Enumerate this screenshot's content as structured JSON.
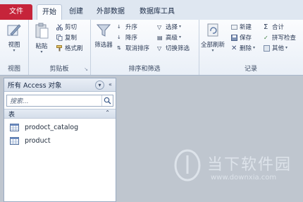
{
  "tabs": {
    "file": "文件",
    "items": [
      "开始",
      "创建",
      "外部数据",
      "数据库工具"
    ]
  },
  "ribbon": {
    "views": {
      "view_label": "视图",
      "group_label": "视图"
    },
    "clipboard": {
      "paste_label": "粘贴",
      "cut": "剪切",
      "copy": "复制",
      "format_painter": "格式刷",
      "group_label": "剪贴板"
    },
    "sort_filter": {
      "filter_label": "筛选器",
      "ascending": "升序",
      "descending": "降序",
      "remove_sort": "取消排序",
      "selection": "选择",
      "advanced": "高级",
      "toggle_filter": "切换筛选",
      "group_label": "排序和筛选"
    },
    "records": {
      "refresh_all": "全部刷新",
      "new": "新建",
      "save": "保存",
      "delete": "删除",
      "totals": "合计",
      "spelling": "拼写检查",
      "more": "其他",
      "group_label": "记录"
    }
  },
  "nav": {
    "title": "所有 Access 对象",
    "search_placeholder": "搜索...",
    "section": "表",
    "items": [
      "prodoct_catalog",
      "product"
    ]
  },
  "watermark": {
    "brand": "当下软件园",
    "url": "www.downxia.com"
  },
  "colors": {
    "file_tab": "#c6243a",
    "workspace": "#bfc6cf"
  }
}
